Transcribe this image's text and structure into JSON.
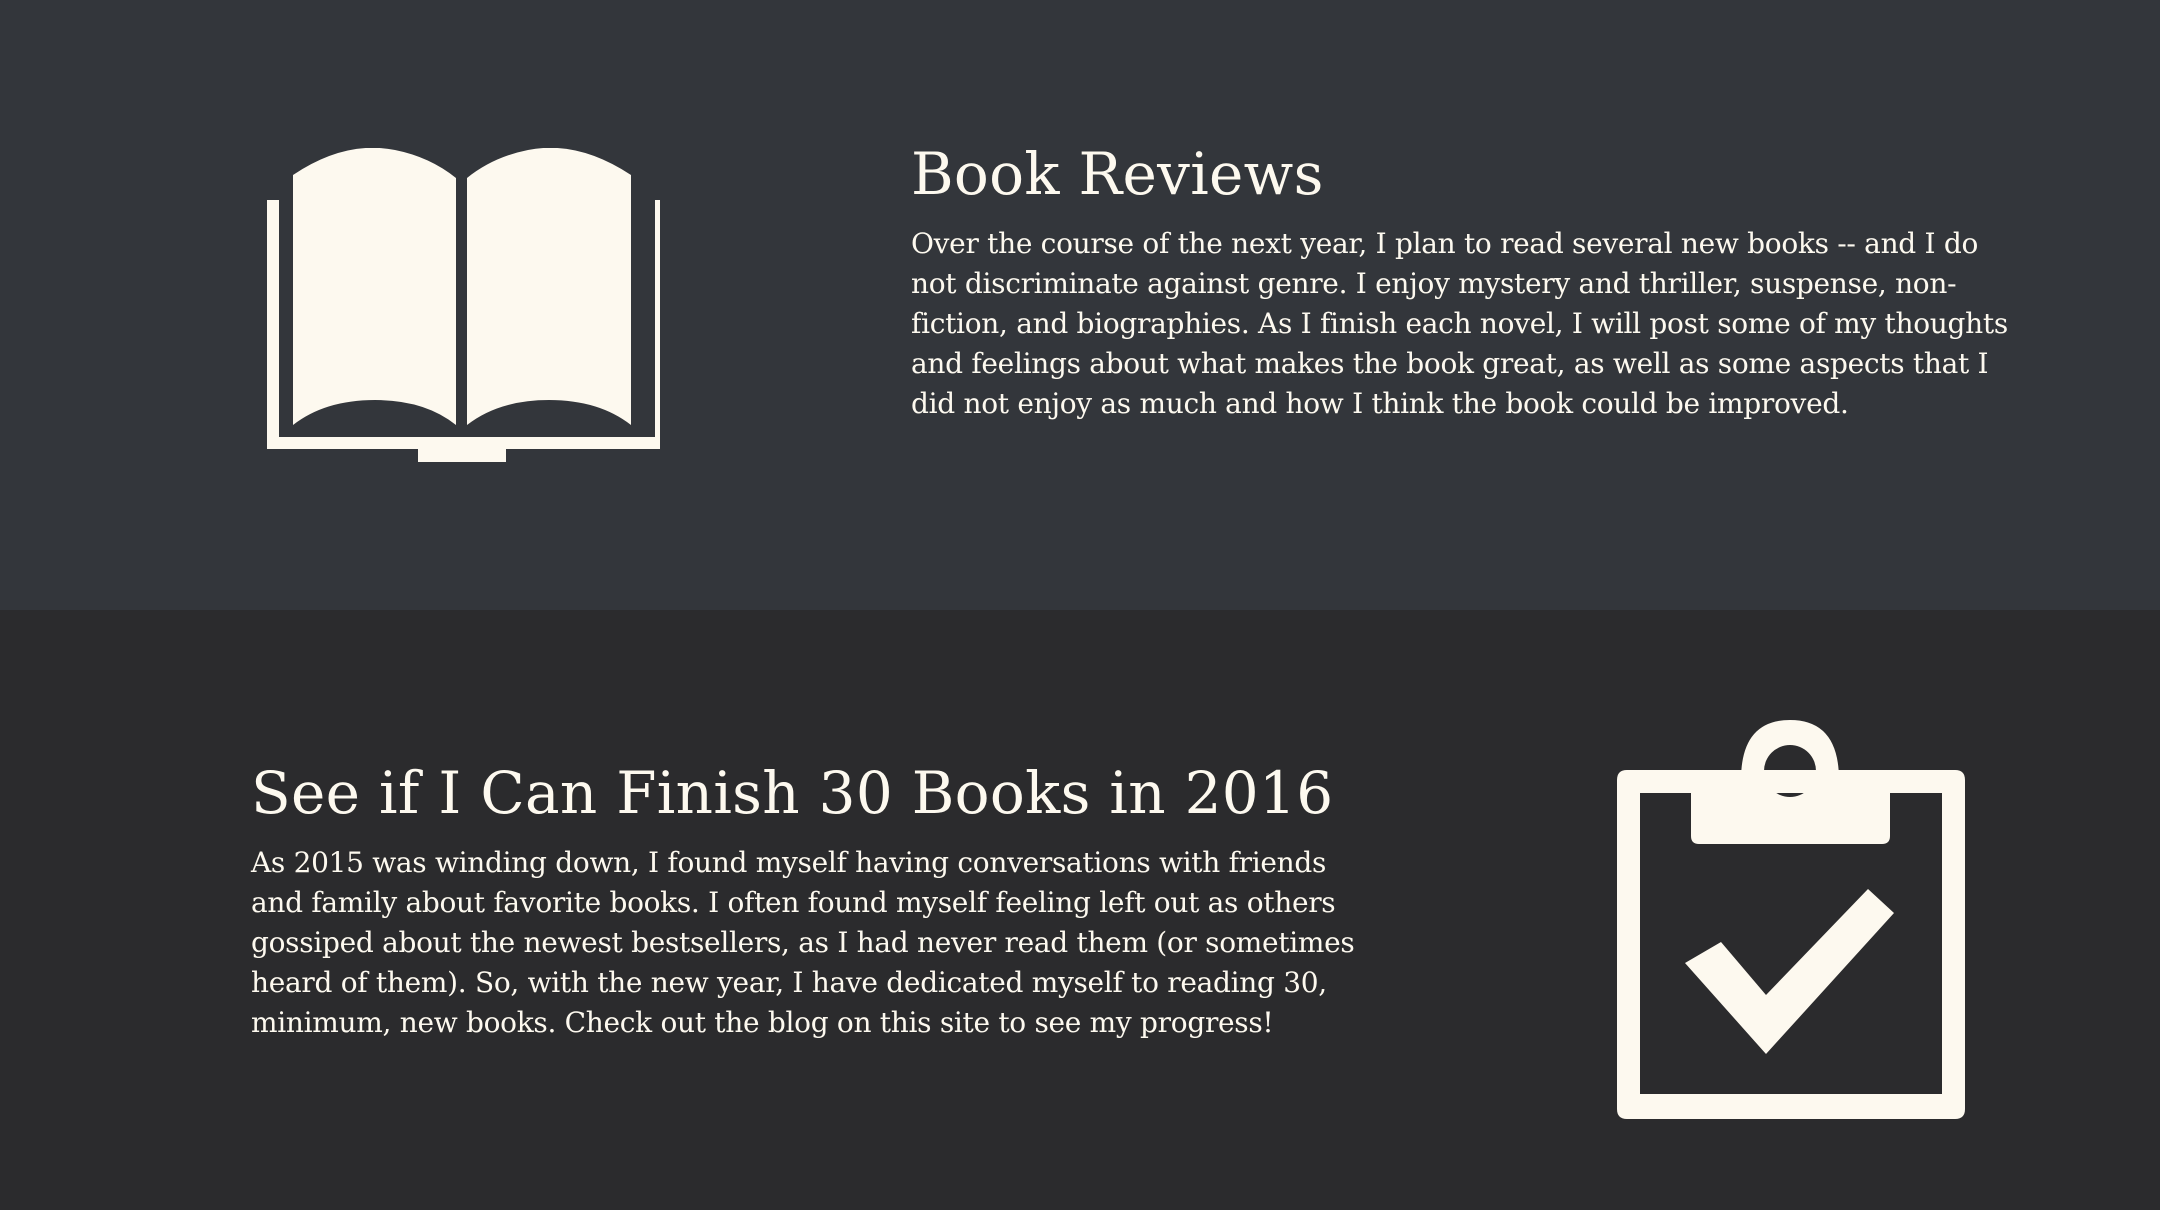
{
  "colors": {
    "top_section_bg": "#33363b",
    "bottom_section_bg": "#2b2b2d",
    "foreground": "#fdf9ef"
  },
  "book_reviews": {
    "icon": "open-book-icon",
    "title": "Book Reviews",
    "body": "Over the course of the next year, I plan to read several new books -- and I do not discriminate against genre. I enjoy mystery and thriller, suspense, non-fiction, and biographies. As I finish each novel, I will post some of my thoughts and feelings about what makes the book great, as well as some aspects that I did not enjoy as much and how I think the book could be improved."
  },
  "challenge": {
    "icon": "clipboard-check-icon",
    "title": "See if I Can Finish 30 Books in 2016",
    "body": "As 2015 was winding down, I found myself having conversations with friends and family about favorite books. I often found myself feeling left out as others gossiped about the newest bestsellers, as I had never read them (or sometimes heard of them). So, with the new year, I have dedicated myself to reading 30, minimum, new books. Check out the blog on this site to see my progress!"
  }
}
